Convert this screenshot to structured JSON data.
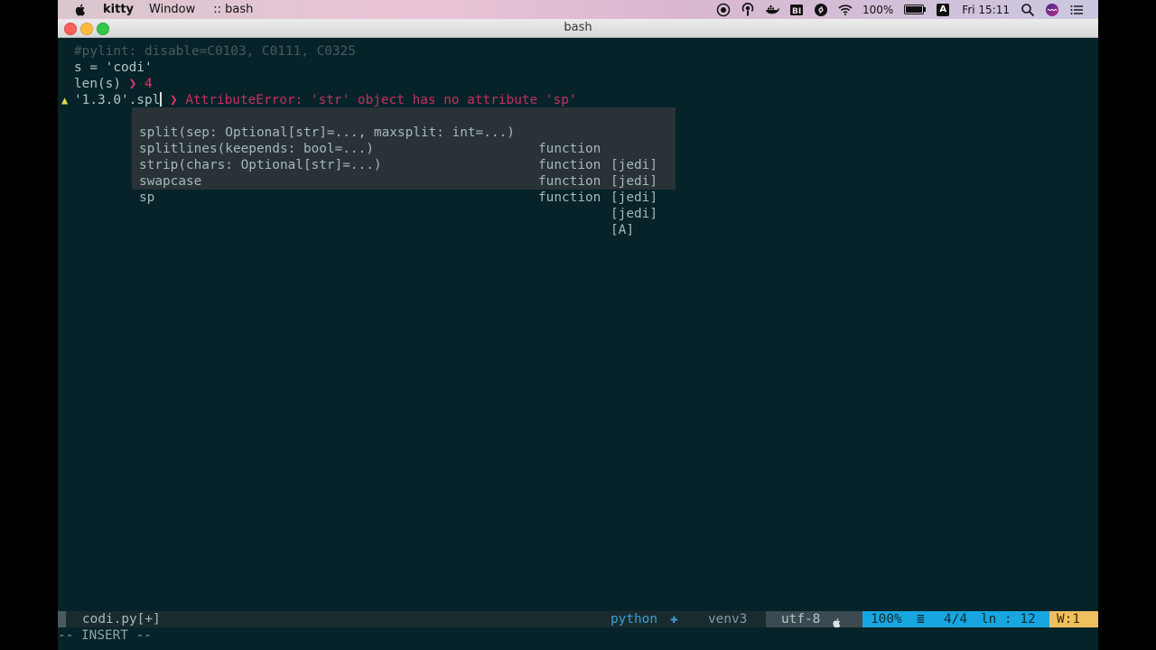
{
  "menubar": {
    "app_name": "kitty",
    "menus": [
      "Window",
      ":: bash"
    ],
    "battery_percent": "100%",
    "battery_level": 1.0,
    "keyboard_indicator": "A",
    "clock": "Fri 15:11",
    "icons": [
      "apple-icon",
      "record-icon",
      "podcast-icon",
      "docker-icon",
      "bi-icon",
      "shazam-icon",
      "wifi-icon",
      "battery-icon",
      "spotlight-icon",
      "siri-icon",
      "list-icon"
    ]
  },
  "window": {
    "title": "bash"
  },
  "editor": {
    "lines": [
      {
        "text": "#pylint: disable=C0103, C0111, C0325",
        "style": "comment"
      },
      {
        "text": "s = 'codi'",
        "style": "code"
      },
      {
        "code": "len(s)",
        "arrow": "❯",
        "result": "4"
      },
      {
        "code": "'1.3.0'.spl",
        "arrow": "❯",
        "error": "AttributeError: 'str' object has no attribute 'sp'",
        "warning": "▲"
      }
    ],
    "completions": [
      {
        "word": "split(sep: Optional[str]=..., maxsplit: int=...)",
        "kind": "function",
        "source": "[jedi]"
      },
      {
        "word": "splitlines(keepends: bool=...)",
        "kind": "function",
        "source": "[jedi]"
      },
      {
        "word": "strip(chars: Optional[str]=...)",
        "kind": "function",
        "source": "[jedi]"
      },
      {
        "word": "swapcase",
        "kind": "function",
        "source": "[jedi]"
      },
      {
        "word": "sp",
        "kind": "",
        "source": "[A]"
      }
    ]
  },
  "statusline": {
    "filename": "codi.py[+]",
    "filetype": "python",
    "filetype_icon": "✚",
    "venv": "venv3",
    "encoding": "utf-8",
    "os_icon": "",
    "percent": "100%",
    "bars": "≣",
    "line": "4/4",
    "column": "ln : 12",
    "warnings": "W:1"
  },
  "cmdline": {
    "mode": "-- INSERT --"
  },
  "colors": {
    "background": "#062329",
    "accent_blue": "#18a6e0",
    "warn_yellow": "#f0c060",
    "error_red": "#c5305f"
  }
}
